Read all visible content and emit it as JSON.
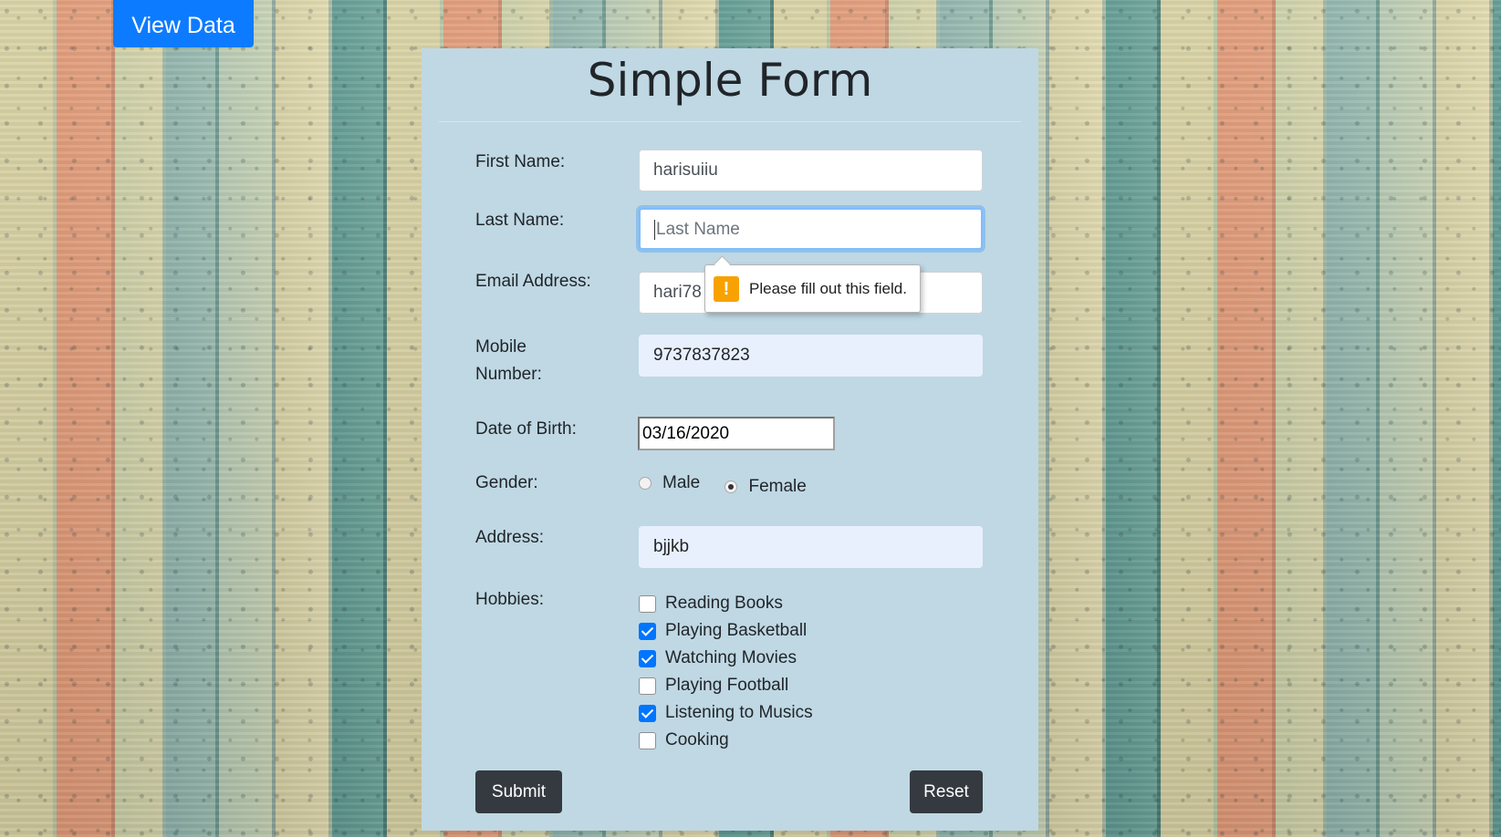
{
  "header": {
    "view_data_label": "View Data"
  },
  "form": {
    "title": "Simple Form",
    "first_name": {
      "label": "First Name:",
      "value": "harisuiiu"
    },
    "last_name": {
      "label": "Last Name:",
      "placeholder": "Last Name",
      "value": ""
    },
    "email": {
      "label": "Email Address:",
      "value": "hari78"
    },
    "mobile": {
      "label_line1": "Mobile",
      "label_line2": "Number:",
      "value": "9737837823"
    },
    "dob": {
      "label": "Date of Birth:",
      "value": "03/16/2020"
    },
    "gender": {
      "label": "Gender:",
      "options": [
        {
          "label": "Male",
          "checked": false
        },
        {
          "label": "Female",
          "checked": true
        }
      ]
    },
    "address": {
      "label": "Address:",
      "value": "bjjkb"
    },
    "hobbies": {
      "label": "Hobbies:",
      "items": [
        {
          "label": "Reading Books",
          "checked": false
        },
        {
          "label": "Playing Basketball",
          "checked": true
        },
        {
          "label": "Watching Movies",
          "checked": true
        },
        {
          "label": "Playing Football",
          "checked": false
        },
        {
          "label": "Listening to Musics",
          "checked": true
        },
        {
          "label": "Cooking",
          "checked": false
        }
      ]
    },
    "submit_label": "Submit",
    "reset_label": "Reset"
  },
  "validation_tooltip": {
    "icon": "warning-icon",
    "message": "Please fill out this field."
  },
  "colors": {
    "primary_button": "#0d7bff",
    "card_background": "#bfd8e4",
    "dark_button": "#343a40",
    "warning": "#f7a200",
    "autofill": "#e8f0fe"
  }
}
